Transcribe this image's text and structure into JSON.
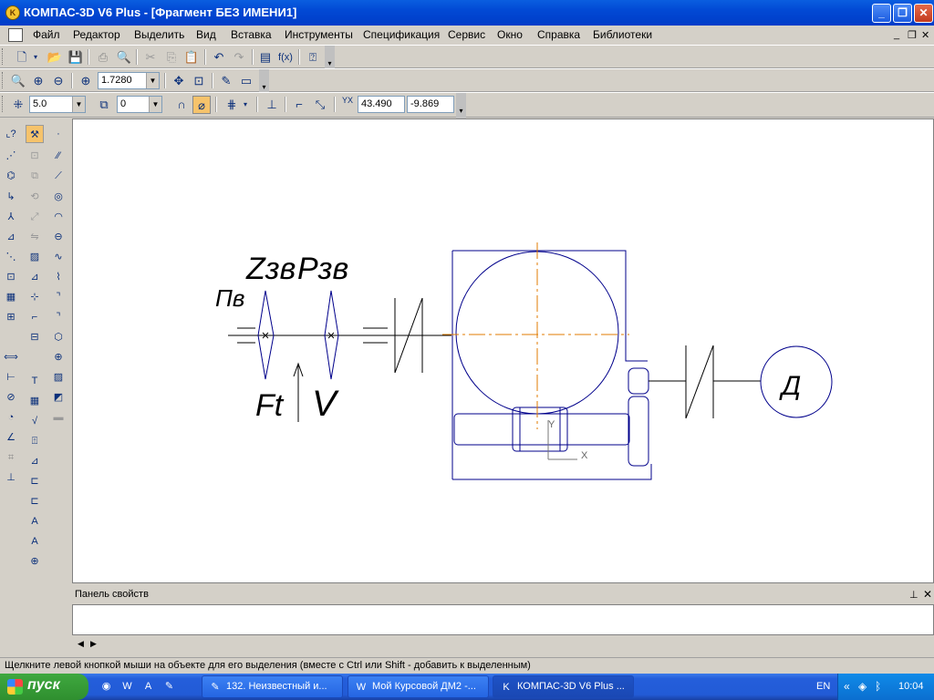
{
  "window": {
    "title": "КОМПАС-3D V6 Plus - [Фрагмент БЕЗ ИМЕНИ1]",
    "app_icon": "kompas-icon"
  },
  "menu": {
    "items": [
      "Файл",
      "Редактор",
      "Выделить",
      "Вид",
      "Вставка",
      "Инструменты",
      "Спецификация",
      "Сервис",
      "Окно",
      "Справка",
      "Библиотеки"
    ]
  },
  "toolbar_view": {
    "zoom_value": "1.7280"
  },
  "toolbar_current": {
    "step": "5.0",
    "layer": "0",
    "cursor_x": "43.490",
    "cursor_y": "-9.869",
    "xy_label": "Y",
    "xy_label2": "X"
  },
  "drawing": {
    "labels": {
      "n_in": "Пв",
      "z": "Zзв",
      "p": "Рзв",
      "ft": "Ft",
      "v": "V",
      "d": "Д"
    },
    "axis_y": "Y",
    "axis_x": "X"
  },
  "properties_panel": {
    "title": "Панель свойств"
  },
  "status": {
    "hint": "Щелкните левой кнопкой мыши на объекте для его выделения (вместе с Ctrl или Shift - добавить к выделенным)"
  },
  "taskbar": {
    "start_label": "пуск",
    "tasks": [
      {
        "label": "132. Неизвестный и...",
        "icon": "pencil-icon"
      },
      {
        "label": "Мой Курсовой ДМ2 -...",
        "icon": "word-icon"
      },
      {
        "label": "КОМПАС-3D V6 Plus ...",
        "icon": "kompas-icon"
      }
    ],
    "lang": "EN",
    "clock": "10:04"
  }
}
